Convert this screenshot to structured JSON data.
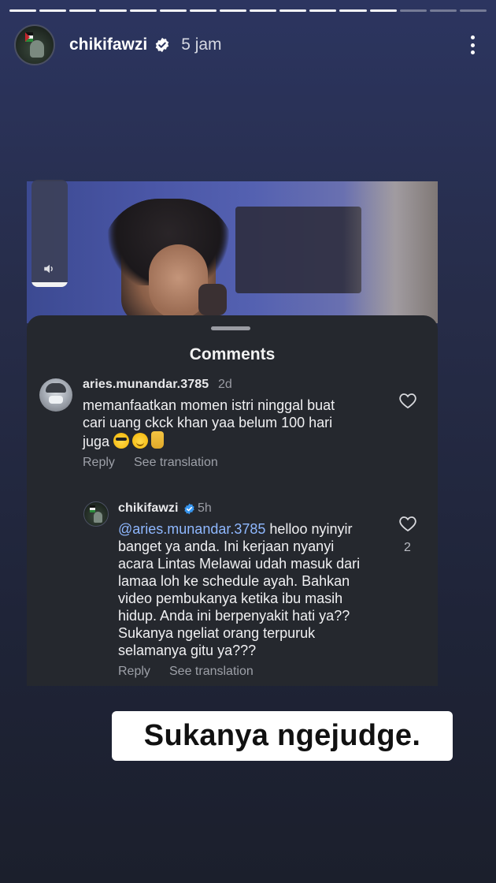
{
  "story": {
    "segments_total": 16,
    "segments_done": 13,
    "username": "chikifawzi",
    "time": "5 jam"
  },
  "comments": {
    "title": "Comments",
    "items": [
      {
        "username": "aries.munandar.3785",
        "time": "2d",
        "text_line1": "memanfaatkan momen istri ninggal buat",
        "text_line2": "cari uang ckck khan yaa belum 100 hari",
        "text_line3": "juga",
        "reply_label": "Reply",
        "translate_label": "See translation"
      },
      {
        "username": "chikifawzi",
        "time": "5h",
        "mention": "@aries.munandar.3785",
        "text_line1": " helloo nyinyir",
        "text_line2": "banget ya anda. Ini kerjaan nyanyi",
        "text_line3": "acara Lintas Melawai udah masuk dari",
        "text_line4": "lamaa loh ke schedule ayah. Bahkan",
        "text_line5": "video pembukanya ketika ibu masih",
        "text_line6": "hidup. Anda ini berpenyakit hati ya??",
        "text_line7": "Sukanya ngeliat orang terpuruk",
        "text_line8": "selamanya gitu ya???",
        "likes": "2",
        "reply_label": "Reply",
        "translate_label": "See translation"
      }
    ]
  },
  "caption": "Sukanya ngejudge.",
  "colors": {
    "mention": "#8fb8ff",
    "verified": "#3897f0"
  },
  "icons": {
    "verified": "verified-badge-icon",
    "more": "more-vertical-icon",
    "volume": "volume-icon",
    "like": "heart-icon"
  }
}
